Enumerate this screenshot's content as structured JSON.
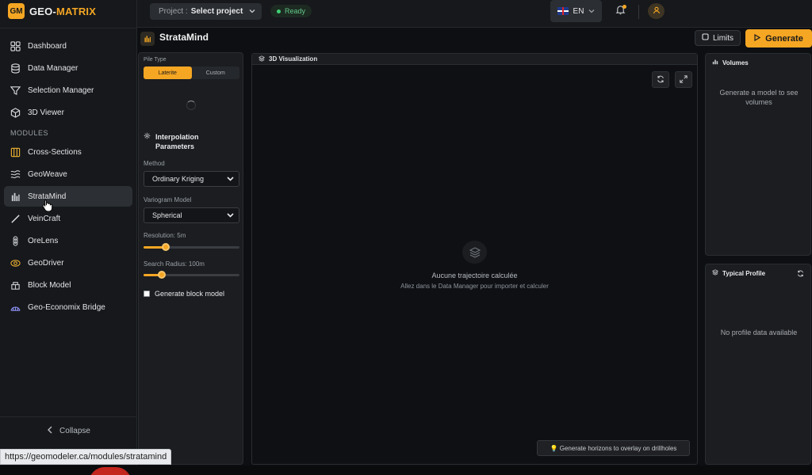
{
  "app": {
    "logo_badge": "GM",
    "logo_text_a": "GEO-",
    "logo_text_b": "MATRIX"
  },
  "sidebar": {
    "items": [
      {
        "label": "Dashboard",
        "icon": "grid-icon"
      },
      {
        "label": "Data Manager",
        "icon": "database-icon"
      },
      {
        "label": "Selection Manager",
        "icon": "filter-icon"
      },
      {
        "label": "3D Viewer",
        "icon": "cube-icon"
      }
    ],
    "section": "MODULES",
    "modules": [
      {
        "label": "Cross-Sections",
        "icon": "cross-sections-icon"
      },
      {
        "label": "GeoWeave",
        "icon": "waves-icon"
      },
      {
        "label": "StrataMind",
        "icon": "strata-icon",
        "active": true
      },
      {
        "label": "VeinCraft",
        "icon": "pen-icon"
      },
      {
        "label": "OreLens",
        "icon": "lens-icon"
      },
      {
        "label": "GeoDriver",
        "icon": "driver-icon"
      },
      {
        "label": "Block Model",
        "icon": "blocks-icon"
      },
      {
        "label": "Geo-Economix Bridge",
        "icon": "bridge-icon"
      }
    ],
    "collapse": "Collapse"
  },
  "topbar": {
    "project_label": "Project :",
    "project_value": "Select project",
    "status": "Ready",
    "language": "EN"
  },
  "page": {
    "title": "StrataMind",
    "limits": "Limits",
    "generate": "Generate"
  },
  "params": {
    "pile_type_label": "Pile Type",
    "pile_types": [
      "Laterite",
      "Custom"
    ],
    "interp_title": "Interpolation Parameters",
    "method_label": "Method",
    "method_value": "Ordinary Kriging",
    "variogram_label": "Variogram Model",
    "variogram_value": "Spherical",
    "resolution_label": "Resolution: 5m",
    "resolution_fraction": 0.23,
    "radius_label": "Search Radius: 100m",
    "radius_fraction": 0.19,
    "block_model_label": "Generate block model"
  },
  "viz": {
    "title": "3D Visualization",
    "empty_title": "Aucune trajectoire calculée",
    "empty_sub": "Allez dans le Data Manager pour importer et calculer",
    "hint": "💡 Generate horizons to overlay on drillholes"
  },
  "volumes": {
    "title": "Volumes",
    "message": "Generate a model to see volumes"
  },
  "profile": {
    "title": "Typical Profile",
    "message": "No profile data available"
  },
  "status_url": "https://geomodeler.ca/modules/stratamind",
  "colors": {
    "accent": "#f5a623",
    "ready": "#3ecf73"
  }
}
